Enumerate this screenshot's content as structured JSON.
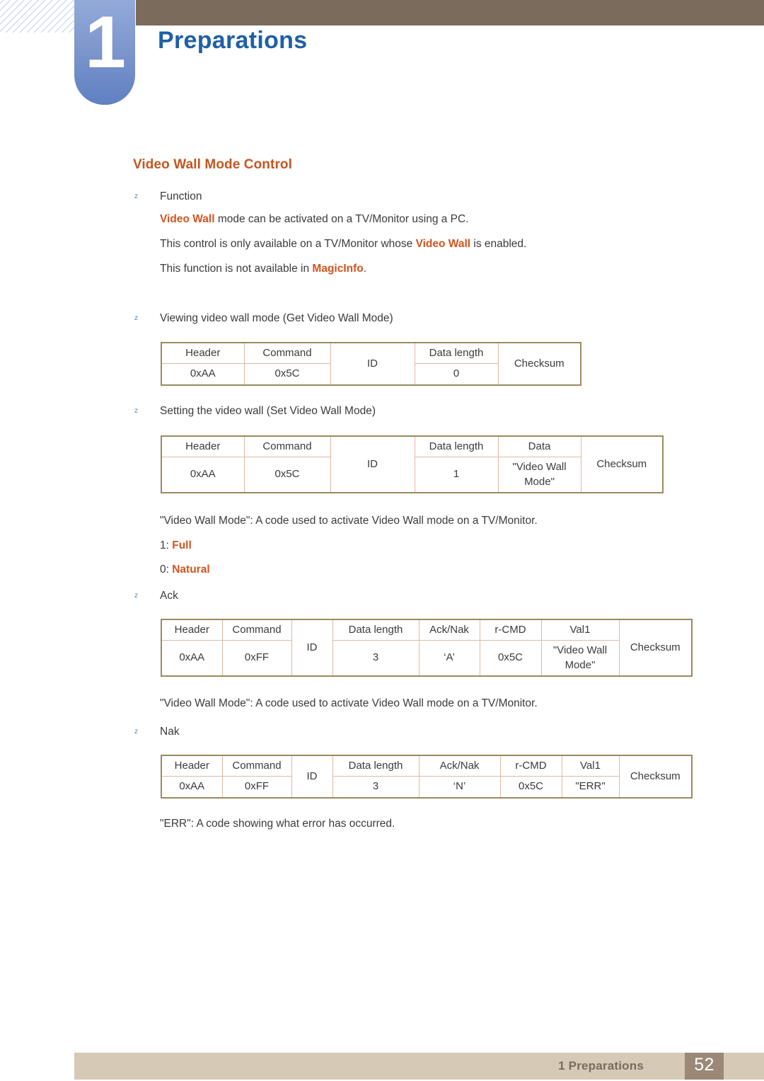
{
  "chapter": {
    "number": "1",
    "title": "Preparations"
  },
  "section": {
    "heading": "Video Wall Mode Control"
  },
  "bullets": {
    "function": "Function",
    "viewing": "Viewing video wall mode (Get Video Wall Mode)",
    "setting": "Setting the video wall (Set Video Wall Mode)",
    "ack": "Ack",
    "nak": "Nak"
  },
  "paragraphs": {
    "func_line1_a": "Video Wall",
    "func_line1_b": " mode can be activated on a TV/Monitor using a PC.",
    "func_line2_a": "This control is only available on a TV/Monitor whose ",
    "func_line2_b": "Video Wall",
    "func_line2_c": " is enabled.",
    "func_line3_a": "This function is not available in ",
    "func_line3_b": "MagicInfo",
    "func_line3_c": ".",
    "videowall_mode_desc": "\"Video Wall Mode\": A code used to activate Video Wall mode on a TV/Monitor.",
    "code_full_prefix": "1: ",
    "code_full_value": "Full",
    "code_natural_prefix": "0: ",
    "code_natural_value": "Natural",
    "err_desc": "\"ERR\": A code showing what error has occurred."
  },
  "tables": {
    "get_video_wall_mode": {
      "headers": [
        "Header",
        "Command",
        "ID",
        "Data length",
        "Checksum"
      ],
      "values": [
        "0xAA",
        "0x5C",
        "0"
      ]
    },
    "set_video_wall_mode": {
      "headers": [
        "Header",
        "Command",
        "ID",
        "Data length",
        "Data",
        "Checksum"
      ],
      "values": [
        "0xAA",
        "0x5C",
        "1",
        "\"Video Wall Mode\""
      ]
    },
    "ack": {
      "headers": [
        "Header",
        "Command",
        "ID",
        "Data length",
        "Ack/Nak",
        "r-CMD",
        "Val1",
        "Checksum"
      ],
      "values": [
        "0xAA",
        "0xFF",
        "3",
        "‘A’",
        "0x5C",
        "\"Video Wall Mode\""
      ]
    },
    "nak": {
      "headers": [
        "Header",
        "Command",
        "ID",
        "Data length",
        "Ack/Nak",
        "r-CMD",
        "Val1",
        "Checksum"
      ],
      "values": [
        "0xAA",
        "0xFF",
        "3",
        "‘N’",
        "0x5C",
        "\"ERR\""
      ]
    }
  },
  "footer": {
    "label": "1 Preparations",
    "page": "52"
  },
  "colors": {
    "accent_orange": "#c4561f",
    "chapter_blue": "#1f5fa8",
    "band_brown": "#7a6b5d",
    "footer_bar": "#d6c9b6",
    "footer_box": "#9b8877",
    "table_border_outer": "#9a8a5e",
    "table_border_inner": "#e0b9a4"
  },
  "icons": {
    "bullet": "z"
  }
}
